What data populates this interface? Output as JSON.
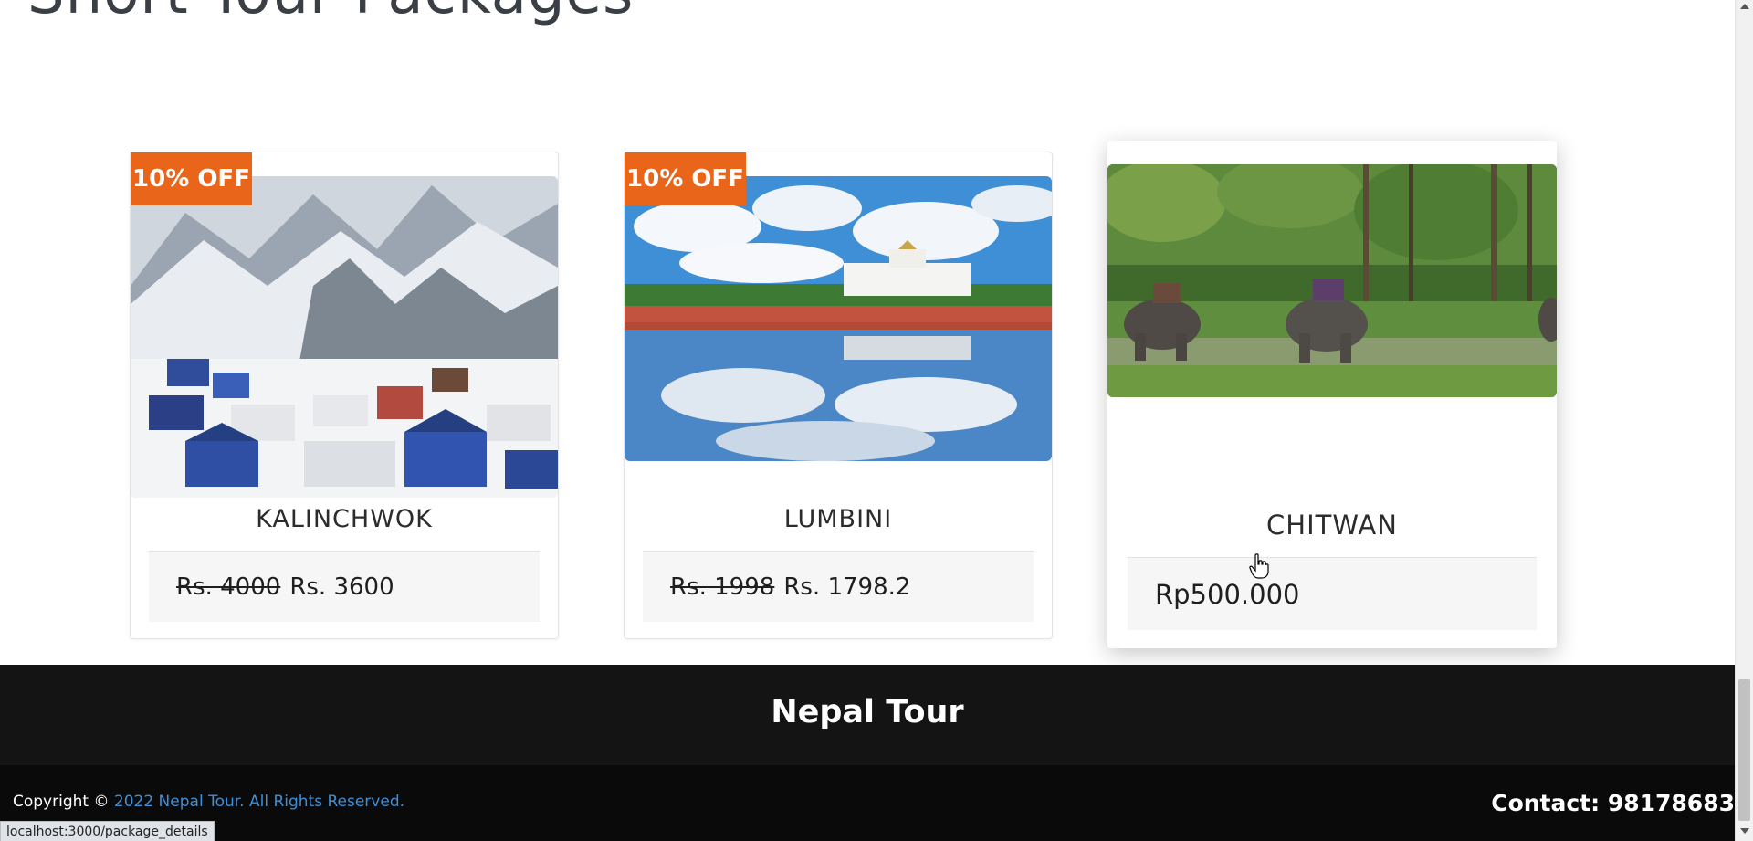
{
  "section": {
    "title": "Short Tour Packages"
  },
  "packages": [
    {
      "badge": "10% OFF",
      "name": "KALINCHWOK",
      "old_price": "Rs. 4000",
      "price": "Rs. 3600"
    },
    {
      "badge": "10% OFF",
      "name": "LUMBINI",
      "old_price": "Rs. 1998",
      "price": "Rs. 1798.2"
    },
    {
      "name": "CHITWAN",
      "price": "Rp500.000"
    }
  ],
  "footer": {
    "brand": "Nepal Tour",
    "copyright_prefix": "Copyright ©",
    "copyright_link": "2022 Nepal Tour. All Rights Reserved.",
    "contact": "Contact: 98178683"
  },
  "status_bar": {
    "url": "localhost:3000/package_details"
  },
  "colors": {
    "badge": "#e8651a",
    "footer_top": "#141414",
    "footer_bottom": "#0a0a0a",
    "link": "#3d8fd8"
  }
}
